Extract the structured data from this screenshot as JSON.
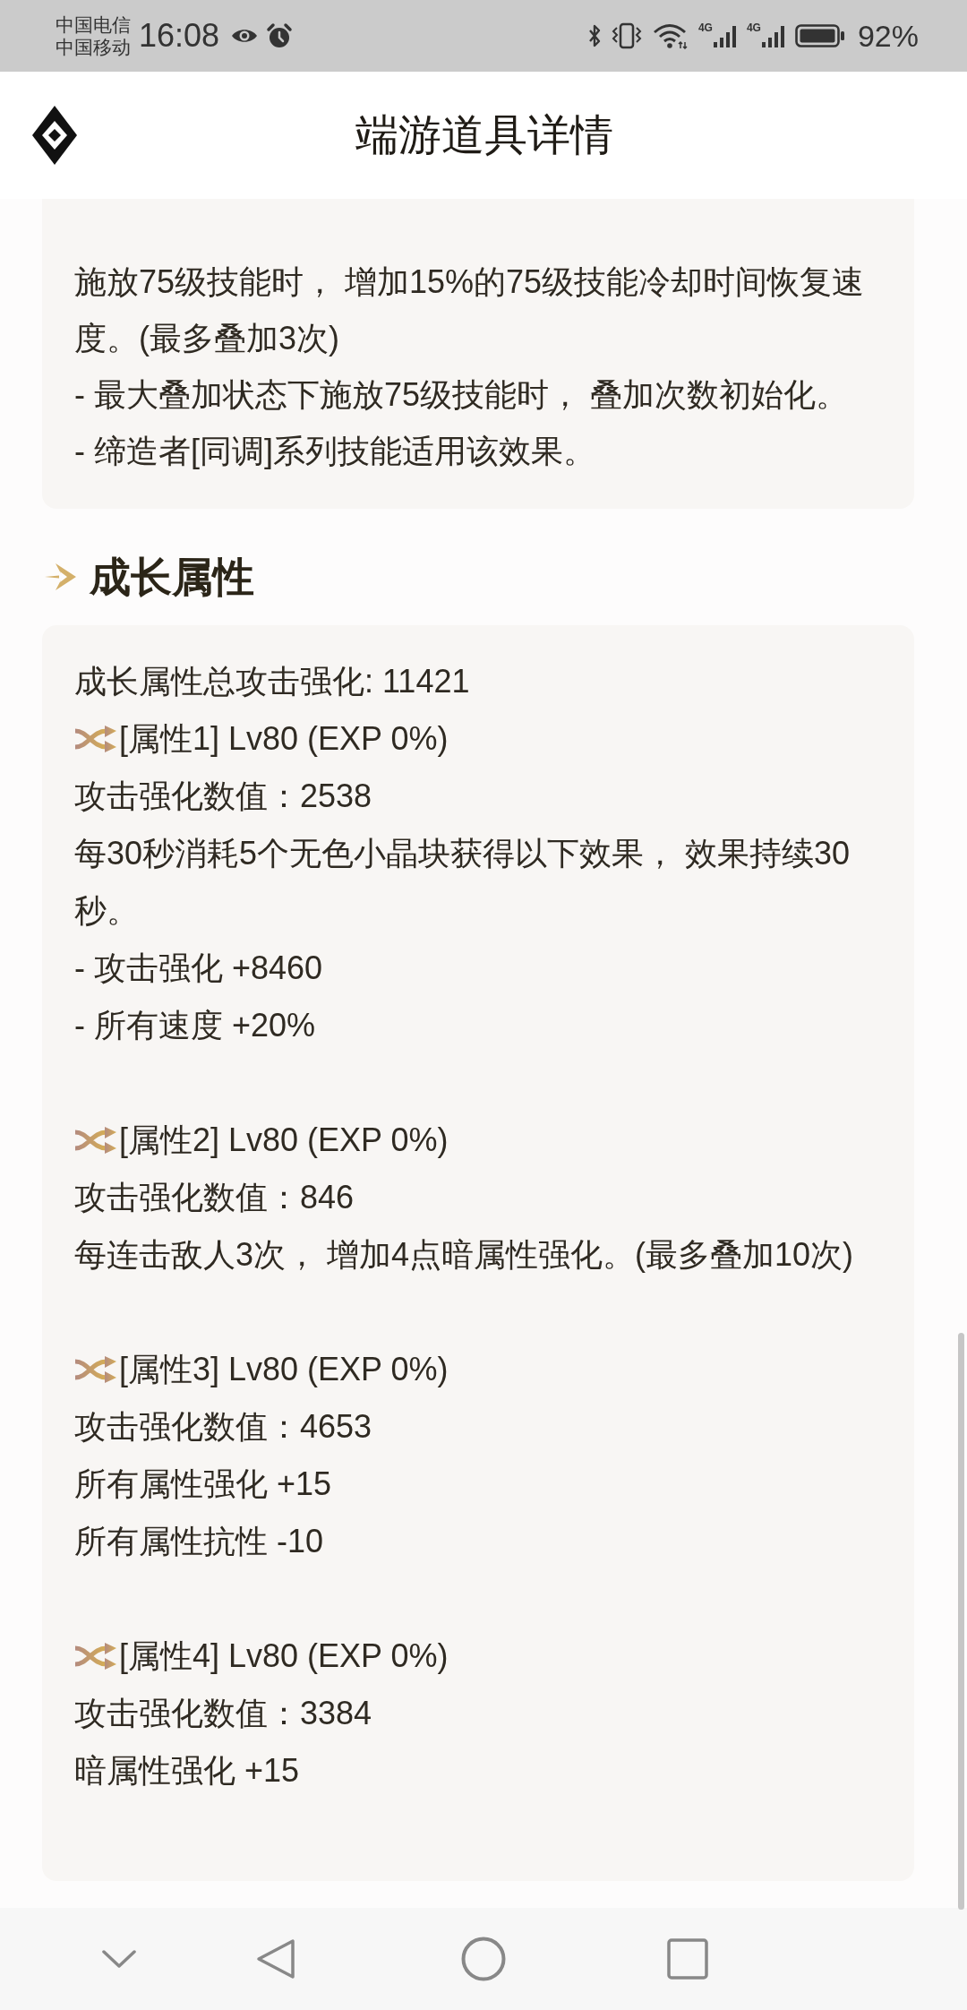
{
  "status_bar": {
    "carriers": [
      "中国电信",
      "中国移动"
    ],
    "time": "16:08",
    "networks": [
      "4G",
      "4G"
    ],
    "battery": "92%"
  },
  "header": {
    "title": "端游道具详情"
  },
  "effect": {
    "lines": [
      "施放75级技能时， 增加15%的75级技能冷却时间恢复速度。(最多叠加3次)",
      "- 最大叠加状态下施放75级技能时， 叠加次数初始化。",
      "- 缔造者[同调]系列技能适用该效果。"
    ]
  },
  "growth": {
    "title": "成长属性",
    "summary": "成长属性总攻击强化: 11421",
    "attributes": [
      {
        "name": "[属性1] Lv80 (EXP 0%)",
        "lines": [
          "攻击强化数值：2538",
          "每30秒消耗5个无色小晶块获得以下效果， 效果持续30秒。",
          "- 攻击强化 +8460",
          "- 所有速度 +20%"
        ]
      },
      {
        "name": "[属性2] Lv80 (EXP 0%)",
        "lines": [
          "攻击强化数值：846",
          "每连击敌人3次， 增加4点暗属性强化。(最多叠加10次)"
        ]
      },
      {
        "name": "[属性3] Lv80 (EXP 0%)",
        "lines": [
          "攻击强化数值：4653",
          "所有属性强化 +15",
          "所有属性抗性 -10"
        ]
      },
      {
        "name": "[属性4] Lv80 (EXP 0%)",
        "lines": [
          "攻击强化数值：3384",
          "暗属性强化 +15"
        ]
      }
    ]
  }
}
